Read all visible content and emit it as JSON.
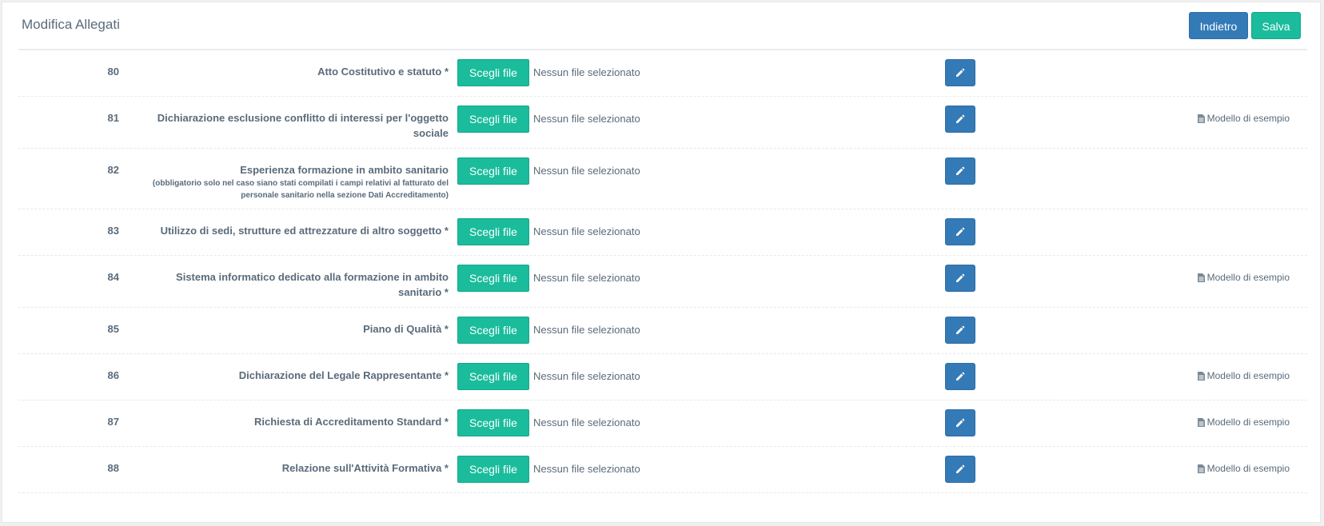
{
  "header": {
    "title": "Modifica Allegati",
    "back_label": "Indietro",
    "save_label": "Salva"
  },
  "rows": [
    {
      "number": "80",
      "label": "Atto Costitutivo e statuto *",
      "sublabel": "",
      "file_button": "Scegli file",
      "file_status": "Nessun file selezionato",
      "model_link": ""
    },
    {
      "number": "81",
      "label": "Dichiarazione esclusione conflitto di interessi per l'oggetto sociale",
      "sublabel": "",
      "file_button": "Scegli file",
      "file_status": "Nessun file selezionato",
      "model_link": "Modello di esempio"
    },
    {
      "number": "82",
      "label": "Esperienza formazione in ambito sanitario",
      "sublabel": "(obbligatorio solo nel caso siano stati compilati i campi relativi al fatturato del personale sanitario nella sezione Dati Accreditamento)",
      "file_button": "Scegli file",
      "file_status": "Nessun file selezionato",
      "model_link": ""
    },
    {
      "number": "83",
      "label": "Utilizzo di sedi, strutture ed attrezzature di altro soggetto *",
      "sublabel": "",
      "file_button": "Scegli file",
      "file_status": "Nessun file selezionato",
      "model_link": ""
    },
    {
      "number": "84",
      "label": "Sistema informatico dedicato alla formazione in ambito sanitario *",
      "sublabel": "",
      "file_button": "Scegli file",
      "file_status": "Nessun file selezionato",
      "model_link": "Modello di esempio"
    },
    {
      "number": "85",
      "label": "Piano di Qualità *",
      "sublabel": "",
      "file_button": "Scegli file",
      "file_status": "Nessun file selezionato",
      "model_link": ""
    },
    {
      "number": "86",
      "label": "Dichiarazione del Legale Rappresentante *",
      "sublabel": "",
      "file_button": "Scegli file",
      "file_status": "Nessun file selezionato",
      "model_link": "Modello di esempio"
    },
    {
      "number": "87",
      "label": "Richiesta di Accreditamento Standard *",
      "sublabel": "",
      "file_button": "Scegli file",
      "file_status": "Nessun file selezionato",
      "model_link": "Modello di esempio"
    },
    {
      "number": "88",
      "label": "Relazione sull'Attività Formativa *",
      "sublabel": "",
      "file_button": "Scegli file",
      "file_status": "Nessun file selezionato",
      "model_link": "Modello di esempio"
    }
  ],
  "icons": {
    "edit": "pencil-icon",
    "model": "file-icon"
  },
  "colors": {
    "primary": "#337ab7",
    "success": "#1abc9c",
    "text": "#5a6b7b"
  }
}
